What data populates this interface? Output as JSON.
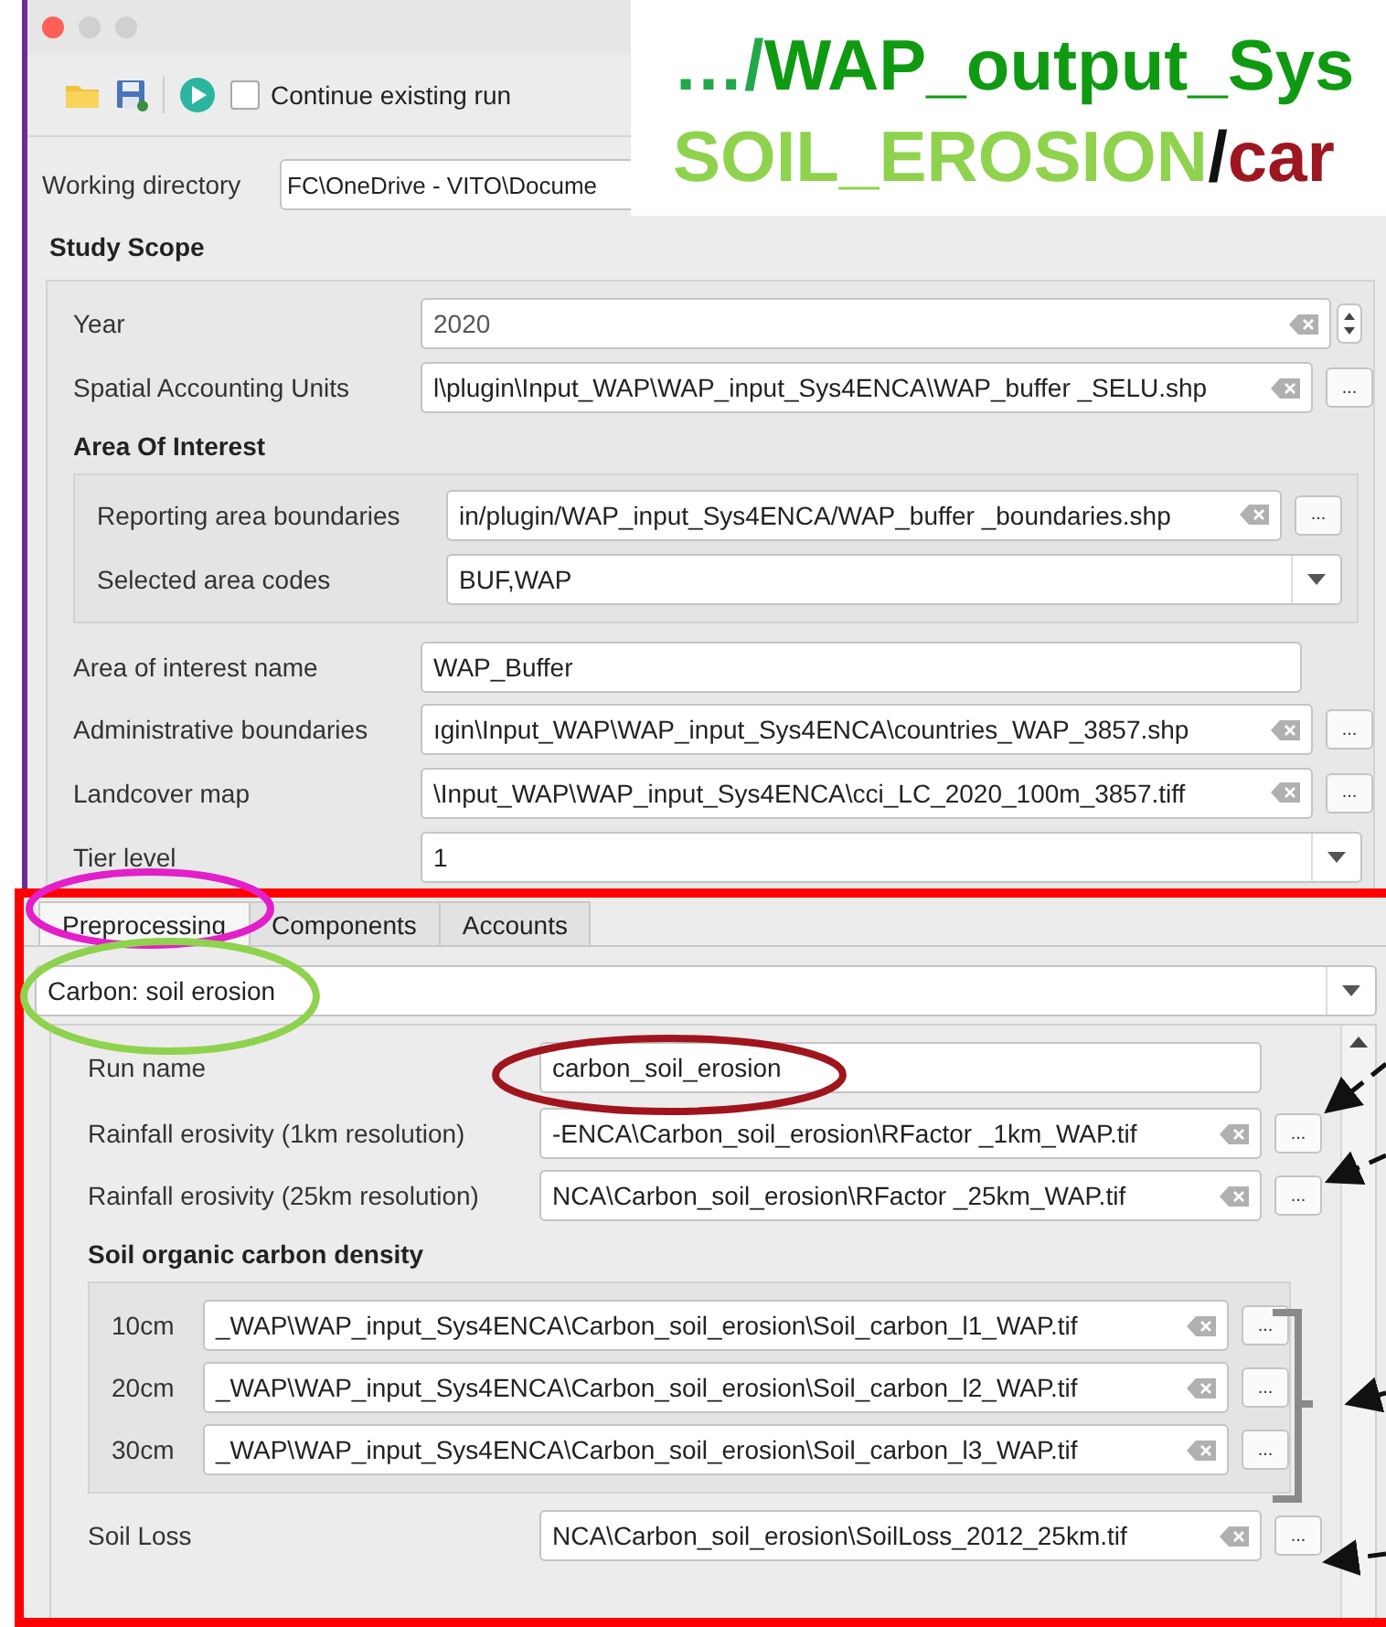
{
  "toolbar": {
    "checkbox": {
      "label": "Continue existing run",
      "checked": false
    }
  },
  "working_directory": {
    "label": "Working directory",
    "value": "FC\\OneDrive - VITO\\Docume"
  },
  "callout": {
    "lines": [
      [
        {
          "text": "…/",
          "color": "#22a84a"
        },
        {
          "text": "WAP_output_Sys",
          "color": "#0f9a12"
        }
      ],
      [
        {
          "text": "SOIL_EROSION",
          "color": "#8fd24e"
        },
        {
          "text": "/",
          "color": "#111111"
        },
        {
          "text": "car",
          "color": "#9e1620"
        }
      ]
    ]
  },
  "study_scope": {
    "title": "Study Scope",
    "rows": [
      {
        "kind": "spin",
        "label": "Year",
        "value": "2020"
      },
      {
        "kind": "file",
        "label": "Spatial Accounting Units",
        "value": "l\\plugin\\Input_WAP\\WAP_input_Sys4ENCA\\WAP_buffer _SELU.shp",
        "button": "..."
      },
      {
        "kind": "group",
        "title": "Area Of Interest",
        "rows": [
          {
            "kind": "file",
            "label": "Reporting area boundaries",
            "value": "in/plugin/WAP_input_Sys4ENCA/WAP_buffer _boundaries.shp",
            "button": "..."
          },
          {
            "kind": "combo",
            "label": "Selected area codes",
            "value": "BUF,WAP"
          }
        ]
      },
      {
        "kind": "text",
        "label": "Area of interest name",
        "value": "WAP_Buffer"
      },
      {
        "kind": "file",
        "label": "Administrative boundaries",
        "value": "ıgin\\Input_WAP\\WAP_input_Sys4ENCA\\countries_WAP_3857.shp",
        "button": "..."
      },
      {
        "kind": "file",
        "label": "Landcover map",
        "value": "\\Input_WAP\\WAP_input_Sys4ENCA\\cci_LC_2020_100m_3857.tiff",
        "button": "..."
      },
      {
        "kind": "combo",
        "label": "Tier level",
        "value": "1"
      }
    ]
  },
  "tabs": [
    {
      "label": "Preprocessing",
      "selected": true
    },
    {
      "label": "Components",
      "selected": false
    },
    {
      "label": "Accounts",
      "selected": false
    }
  ],
  "module_combo": {
    "value": "Carbon: soil erosion"
  },
  "panel": {
    "rows": [
      {
        "kind": "text",
        "label": "Run name",
        "value": "carbon_soil_erosion"
      },
      {
        "kind": "file",
        "label": "Rainfall erosivity (1km resolution)",
        "value": "-ENCA\\Carbon_soil_erosion\\RFactor _1km_WAP.tif",
        "button": "..."
      },
      {
        "kind": "file",
        "label": "Rainfall erosivity (25km resolution)",
        "value": "NCA\\Carbon_soil_erosion\\RFactor _25km_WAP.tif",
        "button": "..."
      },
      {
        "kind": "group",
        "title": "Soil organic carbon density",
        "rows": [
          {
            "kind": "file",
            "label": "10cm",
            "value": "_WAP\\WAP_input_Sys4ENCA\\Carbon_soil_erosion\\Soil_carbon_l1_WAP.tif",
            "button": "..."
          },
          {
            "kind": "file",
            "label": "20cm",
            "value": "_WAP\\WAP_input_Sys4ENCA\\Carbon_soil_erosion\\Soil_carbon_l2_WAP.tif",
            "button": "..."
          },
          {
            "kind": "file",
            "label": "30cm",
            "value": "_WAP\\WAP_input_Sys4ENCA\\Carbon_soil_erosion\\Soil_carbon_l3_WAP.tif",
            "button": "..."
          }
        ]
      },
      {
        "kind": "file",
        "label": "Soil Loss",
        "value": "NCA\\Carbon_soil_erosion\\SoilLoss_2012_25km.tif",
        "button": "..."
      }
    ]
  },
  "annotations": {
    "ellipses": [
      {
        "color": "#e21fc9"
      },
      {
        "color": "#8fd24e"
      },
      {
        "color": "#a0141e"
      }
    ]
  }
}
